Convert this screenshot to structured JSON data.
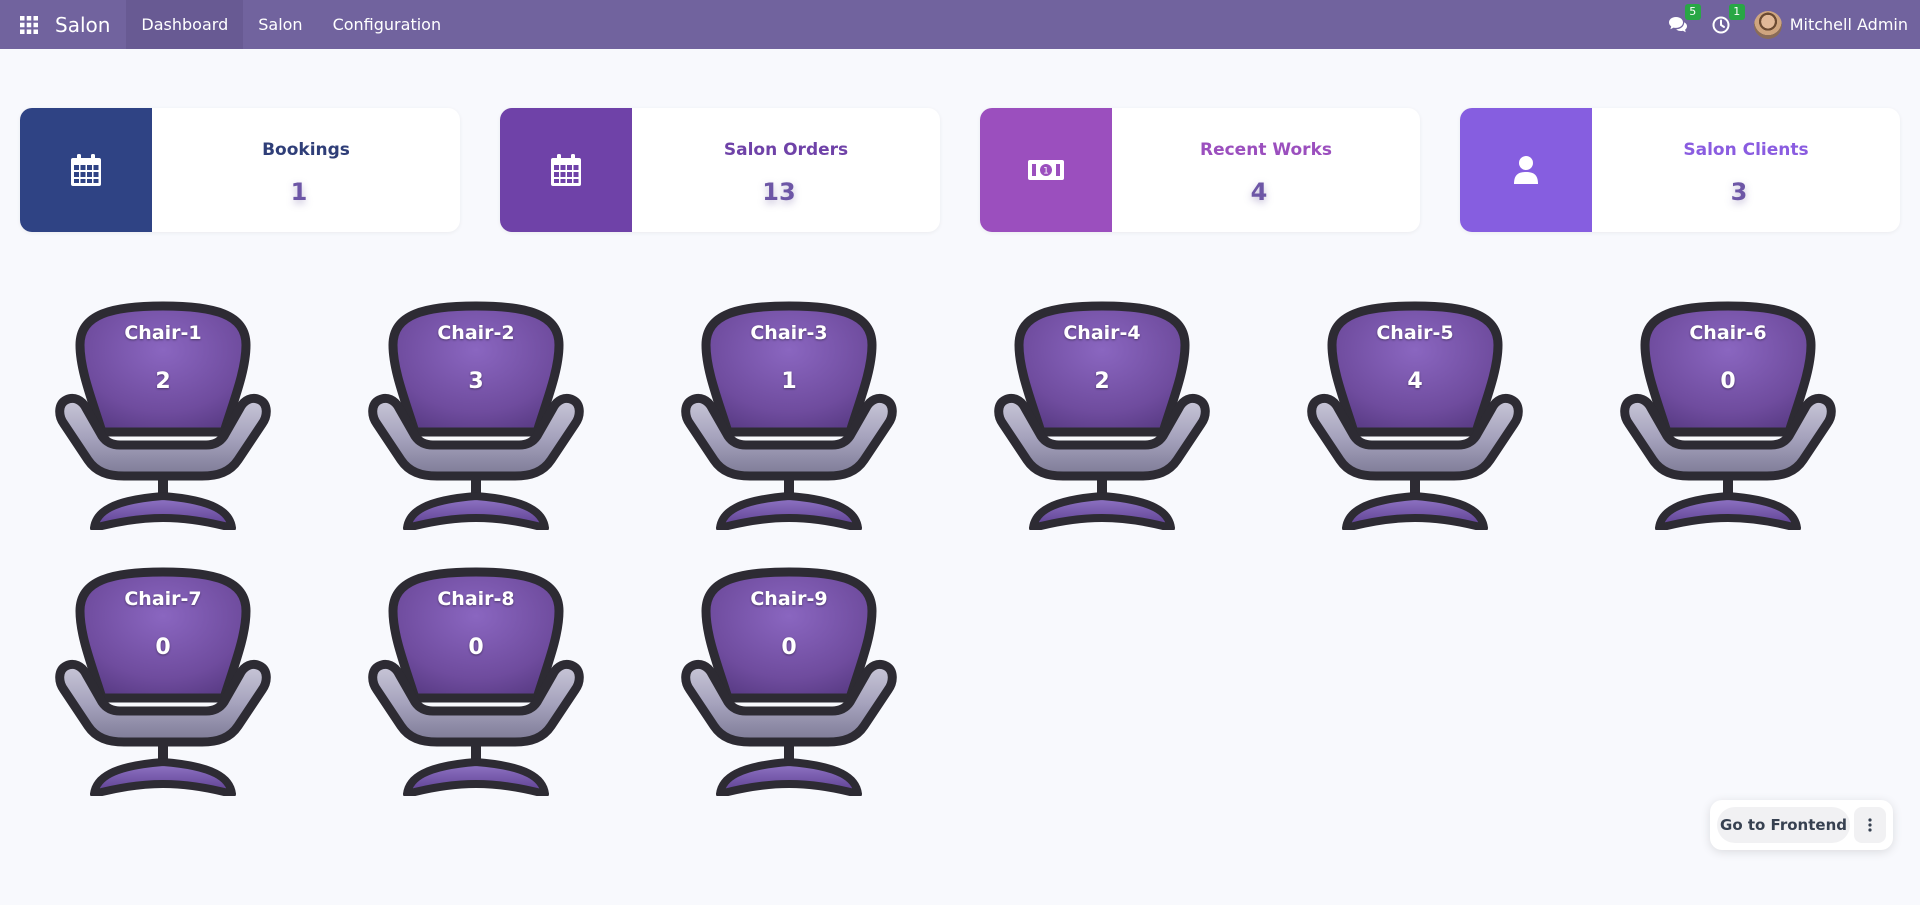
{
  "navbar": {
    "app_title": "Salon",
    "menu": [
      "Dashboard",
      "Salon",
      "Configuration"
    ],
    "active_menu": "Dashboard",
    "messages_count": "5",
    "activities_count": "1",
    "user_name": "Mitchell Admin",
    "icons": {
      "apps": "grid-icon",
      "messages": "chat-icon",
      "activities": "clock-icon"
    }
  },
  "cards": [
    {
      "title": "Bookings",
      "value": "1",
      "icon": "calendar-icon",
      "color": "#2f4384",
      "title_color": "#2f3e78"
    },
    {
      "title": "Salon Orders",
      "value": "13",
      "icon": "calendar-icon",
      "color": "#6f42a8",
      "title_color": "#6f42a8"
    },
    {
      "title": "Recent Works",
      "value": "4",
      "icon": "money-icon",
      "color": "#9b4fbe",
      "title_color": "#9b4fbe"
    },
    {
      "title": "Salon Clients",
      "value": "3",
      "icon": "user-icon",
      "color": "#865ee0",
      "title_color": "#8a5ce0"
    }
  ],
  "chairs": [
    {
      "name": "Chair-1",
      "count": "2"
    },
    {
      "name": "Chair-2",
      "count": "3"
    },
    {
      "name": "Chair-3",
      "count": "1"
    },
    {
      "name": "Chair-4",
      "count": "2"
    },
    {
      "name": "Chair-5",
      "count": "4"
    },
    {
      "name": "Chair-6",
      "count": "0"
    },
    {
      "name": "Chair-7",
      "count": "0"
    },
    {
      "name": "Chair-8",
      "count": "0"
    },
    {
      "name": "Chair-9",
      "count": "0"
    }
  ],
  "frontend": {
    "button_label": "Go to Frontend",
    "more_icon": "vertical-dots-icon"
  }
}
